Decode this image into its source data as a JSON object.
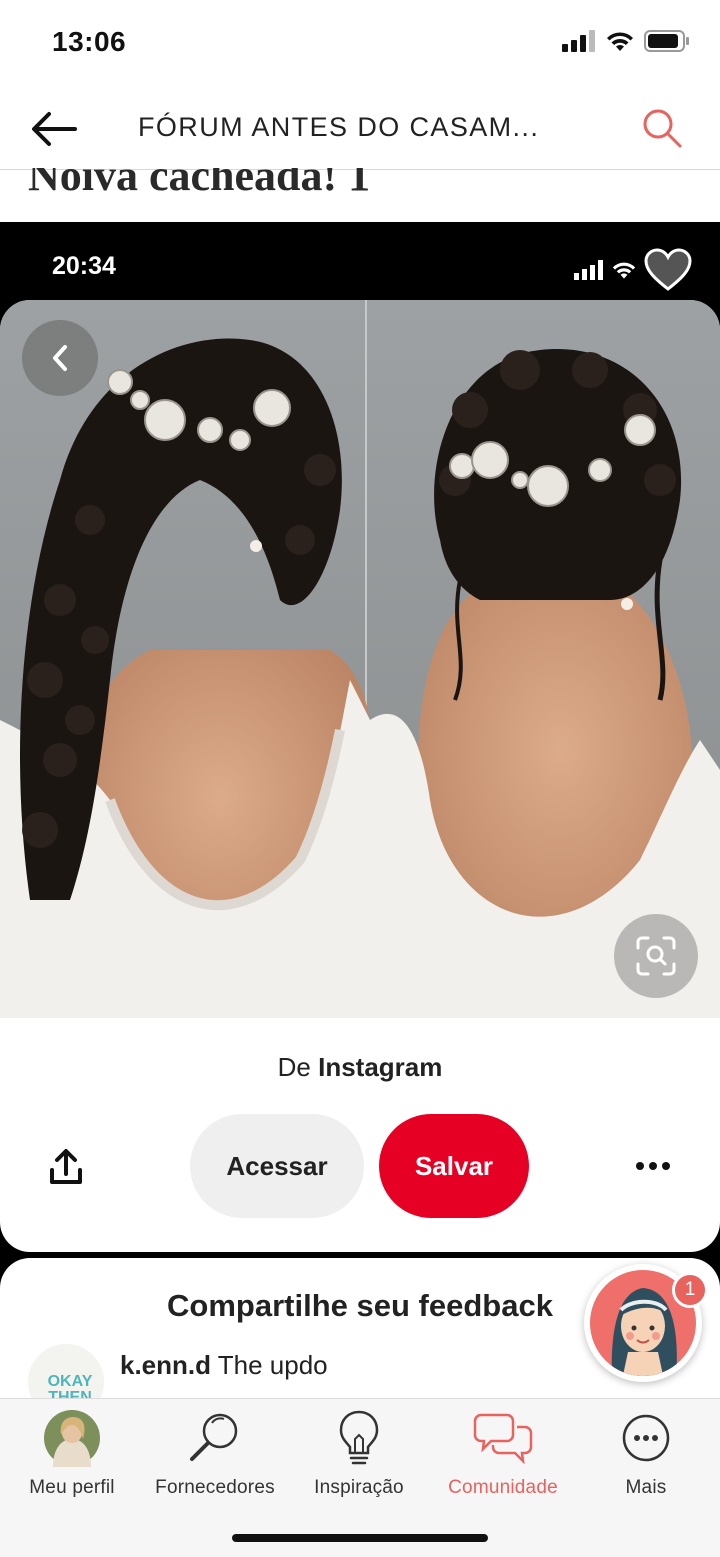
{
  "status_bar": {
    "time": "13:06"
  },
  "header": {
    "back_icon": "arrow-left-icon",
    "title": "FÓRUM ANTES DO CASAM...",
    "search_icon": "search-icon"
  },
  "post": {
    "cut_off_text": "Noiva cacheada! 1"
  },
  "embedded_screenshot": {
    "status_time": "20:34",
    "source_prefix": "De",
    "source_name": "Instagram",
    "visit_label": "Acessar",
    "save_label": "Salvar",
    "feedback_title": "Compartilhe seu feedback",
    "comment": {
      "user": "k.enn.d",
      "text": "The updo",
      "avatar_text": "OKAY THEN"
    },
    "save_color": "#e60023"
  },
  "chat_badge": {
    "count": "1"
  },
  "bottom_nav": {
    "items": [
      {
        "label": "Meu perfil",
        "icon": "profile-photo-icon"
      },
      {
        "label": "Fornecedores",
        "icon": "magnifier-icon"
      },
      {
        "label": "Inspiração",
        "icon": "lightbulb-icon"
      },
      {
        "label": "Comunidade",
        "icon": "chat-bubbles-icon",
        "active": true
      },
      {
        "label": "Mais",
        "icon": "more-icon"
      }
    ],
    "active_color": "#e8625e"
  }
}
